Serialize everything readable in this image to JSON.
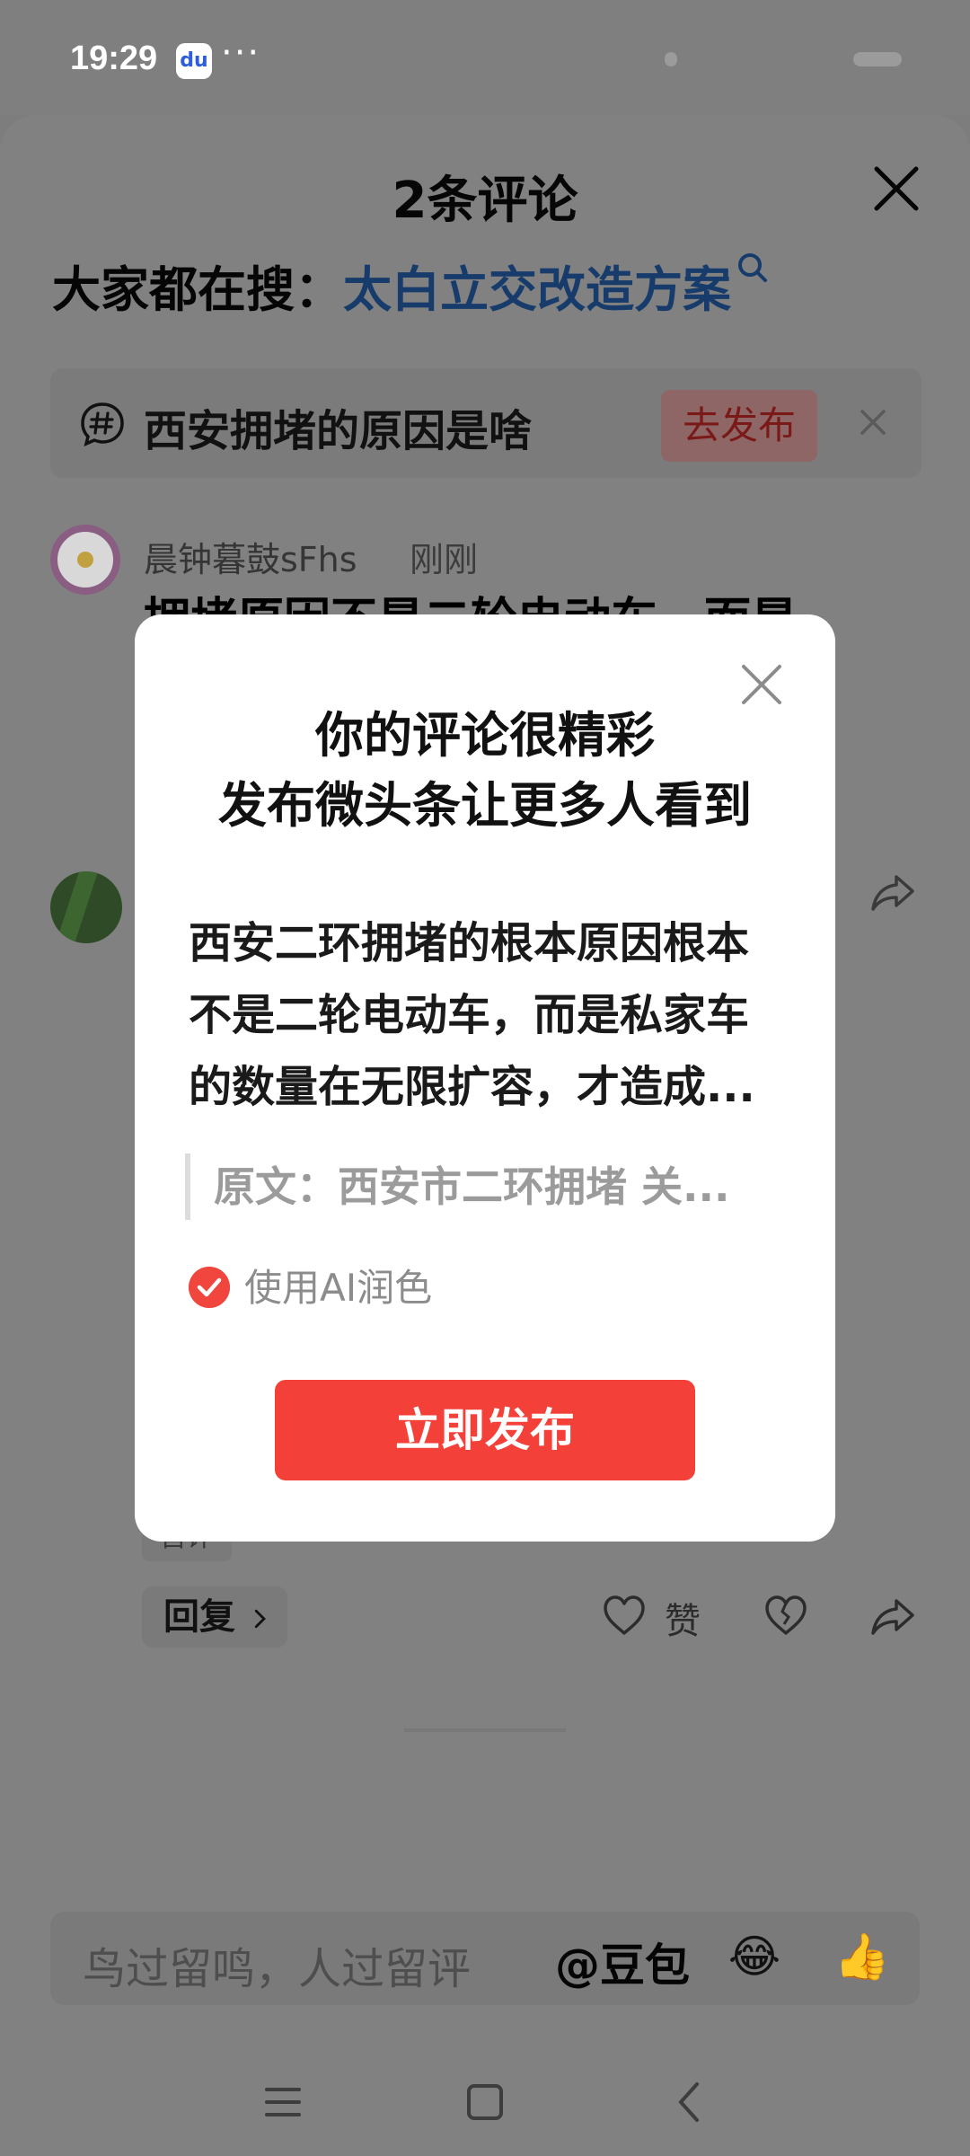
{
  "status_bar": {
    "time": "19:29",
    "app_icon_glyph": "du",
    "more": "···"
  },
  "sheet": {
    "title": "2条评论",
    "search_prefix": "大家都在搜：",
    "search_term": "太白立交改造方案",
    "topic": {
      "text": "西安拥堵的原因是啥",
      "publish_label": "去发布"
    },
    "comment_1": {
      "user": "晨钟暮鼓sFhs",
      "time": "刚刚",
      "body_visible": "拥堵原因不是二轮电动车，而是"
    },
    "tag_chip": "首评",
    "reply_label": "回复",
    "like_label": "赞",
    "input_placeholder": "鸟过留鸣，人过留评",
    "at_doubao": "@豆包"
  },
  "modal": {
    "title_line1": "你的评论很精彩",
    "title_line2": "发布微头条让更多人看到",
    "body_line1": "西安二环拥堵的根本原因根本",
    "body_line2": "不是二轮电动车，而是私家车",
    "body_line3": "的数量在无限扩容，才造成...",
    "quote": "原文：西安市二环拥堵 关...",
    "ai_polish_label": "使用AI润色",
    "ai_polish_checked": true,
    "publish_button": "立即发布"
  },
  "icons": {
    "close": "close-icon",
    "search": "search-icon",
    "topic": "hashtag-icon",
    "share": "share-icon",
    "like": "heart-icon",
    "dislike": "broken-heart-icon",
    "emoji_1": "laughing-face-icon",
    "emoji_2": "thumbs-up-icon",
    "nav_menu": "menu-icon",
    "nav_home": "home-icon",
    "nav_back": "back-icon"
  },
  "colors": {
    "accent_red": "#f3413a",
    "search_term_blue": "#173c6c",
    "overlay_gray": "#7d7d7d"
  }
}
